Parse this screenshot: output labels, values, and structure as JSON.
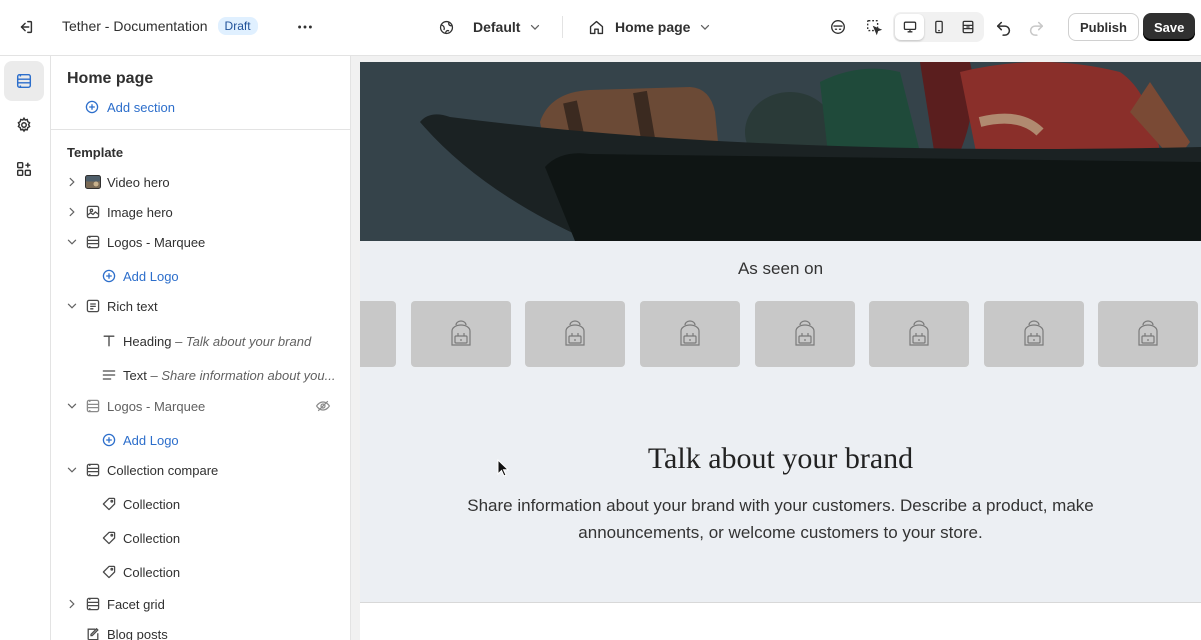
{
  "topbar": {
    "title": "Tether - Documentation",
    "badge": "Draft",
    "theme_selector": "Default",
    "page_selector": "Home page",
    "publish_label": "Publish",
    "save_label": "Save"
  },
  "rail": {
    "items": [
      {
        "name": "sections-icon",
        "active": true
      },
      {
        "name": "settings-icon",
        "active": false
      },
      {
        "name": "apps-icon",
        "active": false
      }
    ]
  },
  "panel": {
    "title": "Home page",
    "add_section": "Add section",
    "template_label": "Template",
    "items": [
      {
        "label": "Video hero",
        "icon": "video-thumbnail-icon",
        "level": 0,
        "expanded": false
      },
      {
        "label": "Image hero",
        "icon": "image-icon",
        "level": 0,
        "expanded": false
      },
      {
        "label": "Logos - Marquee",
        "icon": "marquee-icon",
        "level": 0,
        "expanded": true
      },
      {
        "label": "Add Logo",
        "icon": "plus-circle-icon",
        "level": 1,
        "action": true
      },
      {
        "label": "Rich text",
        "icon": "rich-text-icon",
        "level": 0,
        "expanded": true
      },
      {
        "label": "Heading",
        "detail": "Talk about your brand",
        "icon": "heading-icon",
        "level": 1
      },
      {
        "label": "Text",
        "detail": "Share information about you...",
        "icon": "text-icon",
        "level": 1
      },
      {
        "label": "Logos - Marquee",
        "icon": "marquee-icon",
        "level": 0,
        "expanded": true,
        "hidden": true
      },
      {
        "label": "Add Logo",
        "icon": "plus-circle-icon",
        "level": 1,
        "action": true
      },
      {
        "label": "Collection compare",
        "icon": "marquee-icon",
        "level": 0,
        "expanded": true
      },
      {
        "label": "Collection",
        "icon": "tag-icon",
        "level": 1
      },
      {
        "label": "Collection",
        "icon": "tag-icon",
        "level": 1
      },
      {
        "label": "Collection",
        "icon": "tag-icon",
        "level": 1
      },
      {
        "label": "Facet grid",
        "icon": "marquee-icon",
        "level": 0,
        "expanded": false
      },
      {
        "label": "Blog posts",
        "icon": "blog-icon",
        "level": 0,
        "expanded": false
      }
    ]
  },
  "preview": {
    "seen_on": "As seen on",
    "brand_heading": "Talk about your brand",
    "brand_text": "Share information about your brand with your customers. Describe a product, make announcements, or welcome customers to your store."
  },
  "colors": {
    "accent": "#2c6ecb",
    "badge_bg": "#e0f0ff",
    "save_bg": "#303030",
    "canvas_bg": "#eceff3",
    "logo_tile": "#c8c8c8"
  }
}
